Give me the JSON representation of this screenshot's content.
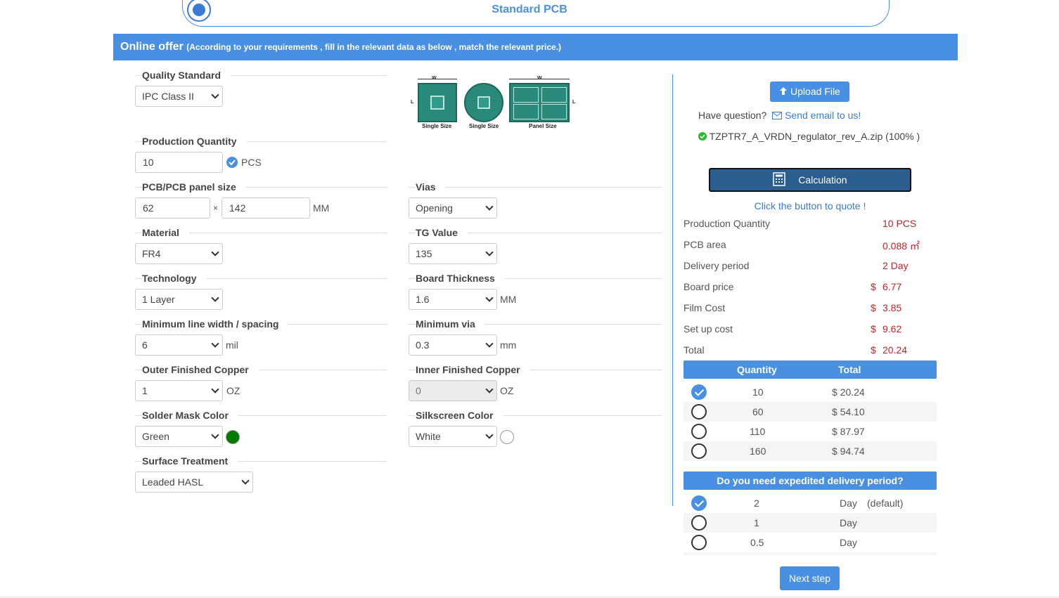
{
  "header": {
    "tab_title": "Standard PCB"
  },
  "banner": {
    "title": "Online offer",
    "subtitle": "(According to your requirements ,   fill in the relevant data as below ,   match the relevant price.)"
  },
  "form": {
    "quality_standard": {
      "label": "Quality Standard",
      "value": "IPC Class II"
    },
    "production_quantity": {
      "label": "Production Quantity",
      "value": "10",
      "unit": "PCS"
    },
    "panel_size": {
      "label": "PCB/PCB panel size",
      "width": "62",
      "sep": "×",
      "height": "142",
      "unit": "MM"
    },
    "material": {
      "label": "Material",
      "value": "FR4"
    },
    "technology": {
      "label": "Technology",
      "value": "1 Layer"
    },
    "min_line": {
      "label": "Minimum line width / spacing",
      "value": "6",
      "unit": "mil"
    },
    "outer_copper": {
      "label": "Outer Finished Copper",
      "value": "1",
      "unit": "OZ"
    },
    "solder_mask": {
      "label": "Solder Mask Color",
      "value": "Green",
      "color": "#007a00"
    },
    "surface": {
      "label": "Surface Treatment",
      "value": "Leaded HASL"
    },
    "vias": {
      "label": "Vias",
      "value": "Opening"
    },
    "tg": {
      "label": "TG Value",
      "value": "135"
    },
    "thickness": {
      "label": "Board Thickness",
      "value": "1.6",
      "unit": "MM"
    },
    "min_via": {
      "label": "Minimum via",
      "value": "0.3",
      "unit": "mm"
    },
    "inner_copper": {
      "label": "Inner Finished Copper",
      "value": "0",
      "unit": "OZ"
    },
    "silkscreen": {
      "label": "Silkscreen Color",
      "value": "White",
      "color": "#ffffff"
    },
    "images": {
      "cap1": "Single Size",
      "cap2": "Single Size",
      "cap3": "Panel Size",
      "w": "W",
      "l": "L"
    }
  },
  "upload": {
    "button": "Upload File",
    "question": "Have question?",
    "email_link": "Send email to us!",
    "file": "TZPTR7_A_VRDN_regulator_rev_A.zip (100% )"
  },
  "calc": {
    "button": "Calculation",
    "hint": "Click the button to quote !"
  },
  "summary": [
    {
      "label": "Production Quantity",
      "value": "10 PCS"
    },
    {
      "label": "PCB area",
      "value": "0.088 ㎡"
    },
    {
      "label": "Delivery period",
      "value": "2 Day"
    },
    {
      "label": "Board price",
      "currency": "$",
      "value": "6.77"
    },
    {
      "label": "Film Cost",
      "currency": "$",
      "value": "3.85"
    },
    {
      "label": "Set up cost",
      "currency": "$",
      "value": "9.62"
    },
    {
      "label": "Total",
      "currency": "$",
      "value": "20.24"
    }
  ],
  "qty_table": {
    "headers": [
      "Quantity",
      "Total"
    ],
    "rows": [
      {
        "qty": "10",
        "total": "$ 20.24",
        "selected": true
      },
      {
        "qty": "60",
        "total": "$ 54.10",
        "selected": false
      },
      {
        "qty": "110",
        "total": "$ 87.97",
        "selected": false
      },
      {
        "qty": "160",
        "total": "$ 94.74",
        "selected": false
      }
    ]
  },
  "delivery_table": {
    "header": "Do you need expedited delivery period?",
    "rows": [
      {
        "days": "2",
        "unit": "Day",
        "note": "(default)",
        "selected": true
      },
      {
        "days": "1",
        "unit": "Day",
        "note": "",
        "selected": false
      },
      {
        "days": "0.5",
        "unit": "Day",
        "note": "",
        "selected": false
      }
    ]
  },
  "next_button": "Next step",
  "colors": {
    "accent": "#4a90e2",
    "price": "#c0262d",
    "calc": "#2b5d8f"
  }
}
